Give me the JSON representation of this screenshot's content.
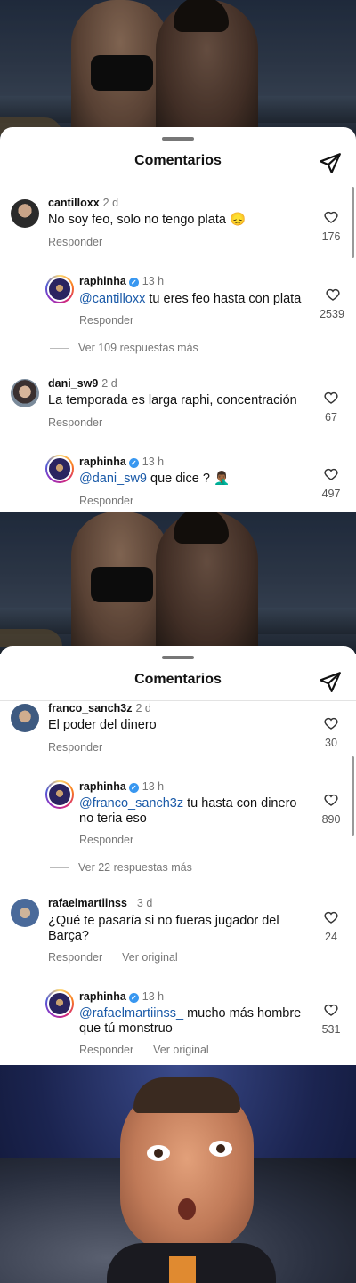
{
  "panels": [
    {
      "title": "Comentarios",
      "threads": [
        {
          "username": "cantilloxx",
          "time": "2 d",
          "text": "No soy feo, solo no tengo plata 😞",
          "reply_label": "Responder",
          "likes": "176"
        },
        {
          "username": "raphinha",
          "time": "13 h",
          "mention": "@cantilloxx",
          "text": " tu eres feo hasta con plata",
          "reply_label": "Responder",
          "likes": "2539"
        },
        {
          "more": "Ver 109 respuestas más"
        },
        {
          "username": "dani_sw9",
          "time": "2 d",
          "text": "La temporada es larga raphi, concentración",
          "reply_label": "Responder",
          "likes": "67"
        },
        {
          "username": "raphinha",
          "time": "13 h",
          "mention": "@dani_sw9",
          "text": " que dice ? 🤦🏾‍♂️",
          "reply_label": "Responder",
          "likes": "497"
        }
      ]
    },
    {
      "title": "Comentarios",
      "threads": [
        {
          "username": "franco_sanch3z",
          "time": "2 d",
          "text": "El poder del dinero",
          "reply_label": "Responder",
          "likes": "30"
        },
        {
          "username": "raphinha",
          "time": "13 h",
          "mention": "@franco_sanch3z",
          "text": " tu hasta con dinero no teria eso",
          "reply_label": "Responder",
          "likes": "890"
        },
        {
          "more": "Ver 22 respuestas más"
        },
        {
          "username": "rafaelmartiinss_",
          "time": "3 d",
          "text": "¿Qué te pasaría si no fueras jugador del Barça?",
          "reply_label": "Responder",
          "translate_label": "Ver original",
          "likes": "24"
        },
        {
          "username": "raphinha",
          "time": "13 h",
          "mention": "@rafaelmartiinss_",
          "text": " mucho más hombre que tú monstruo",
          "reply_label": "Responder",
          "translate_label": "Ver original",
          "likes": "531"
        }
      ]
    }
  ]
}
